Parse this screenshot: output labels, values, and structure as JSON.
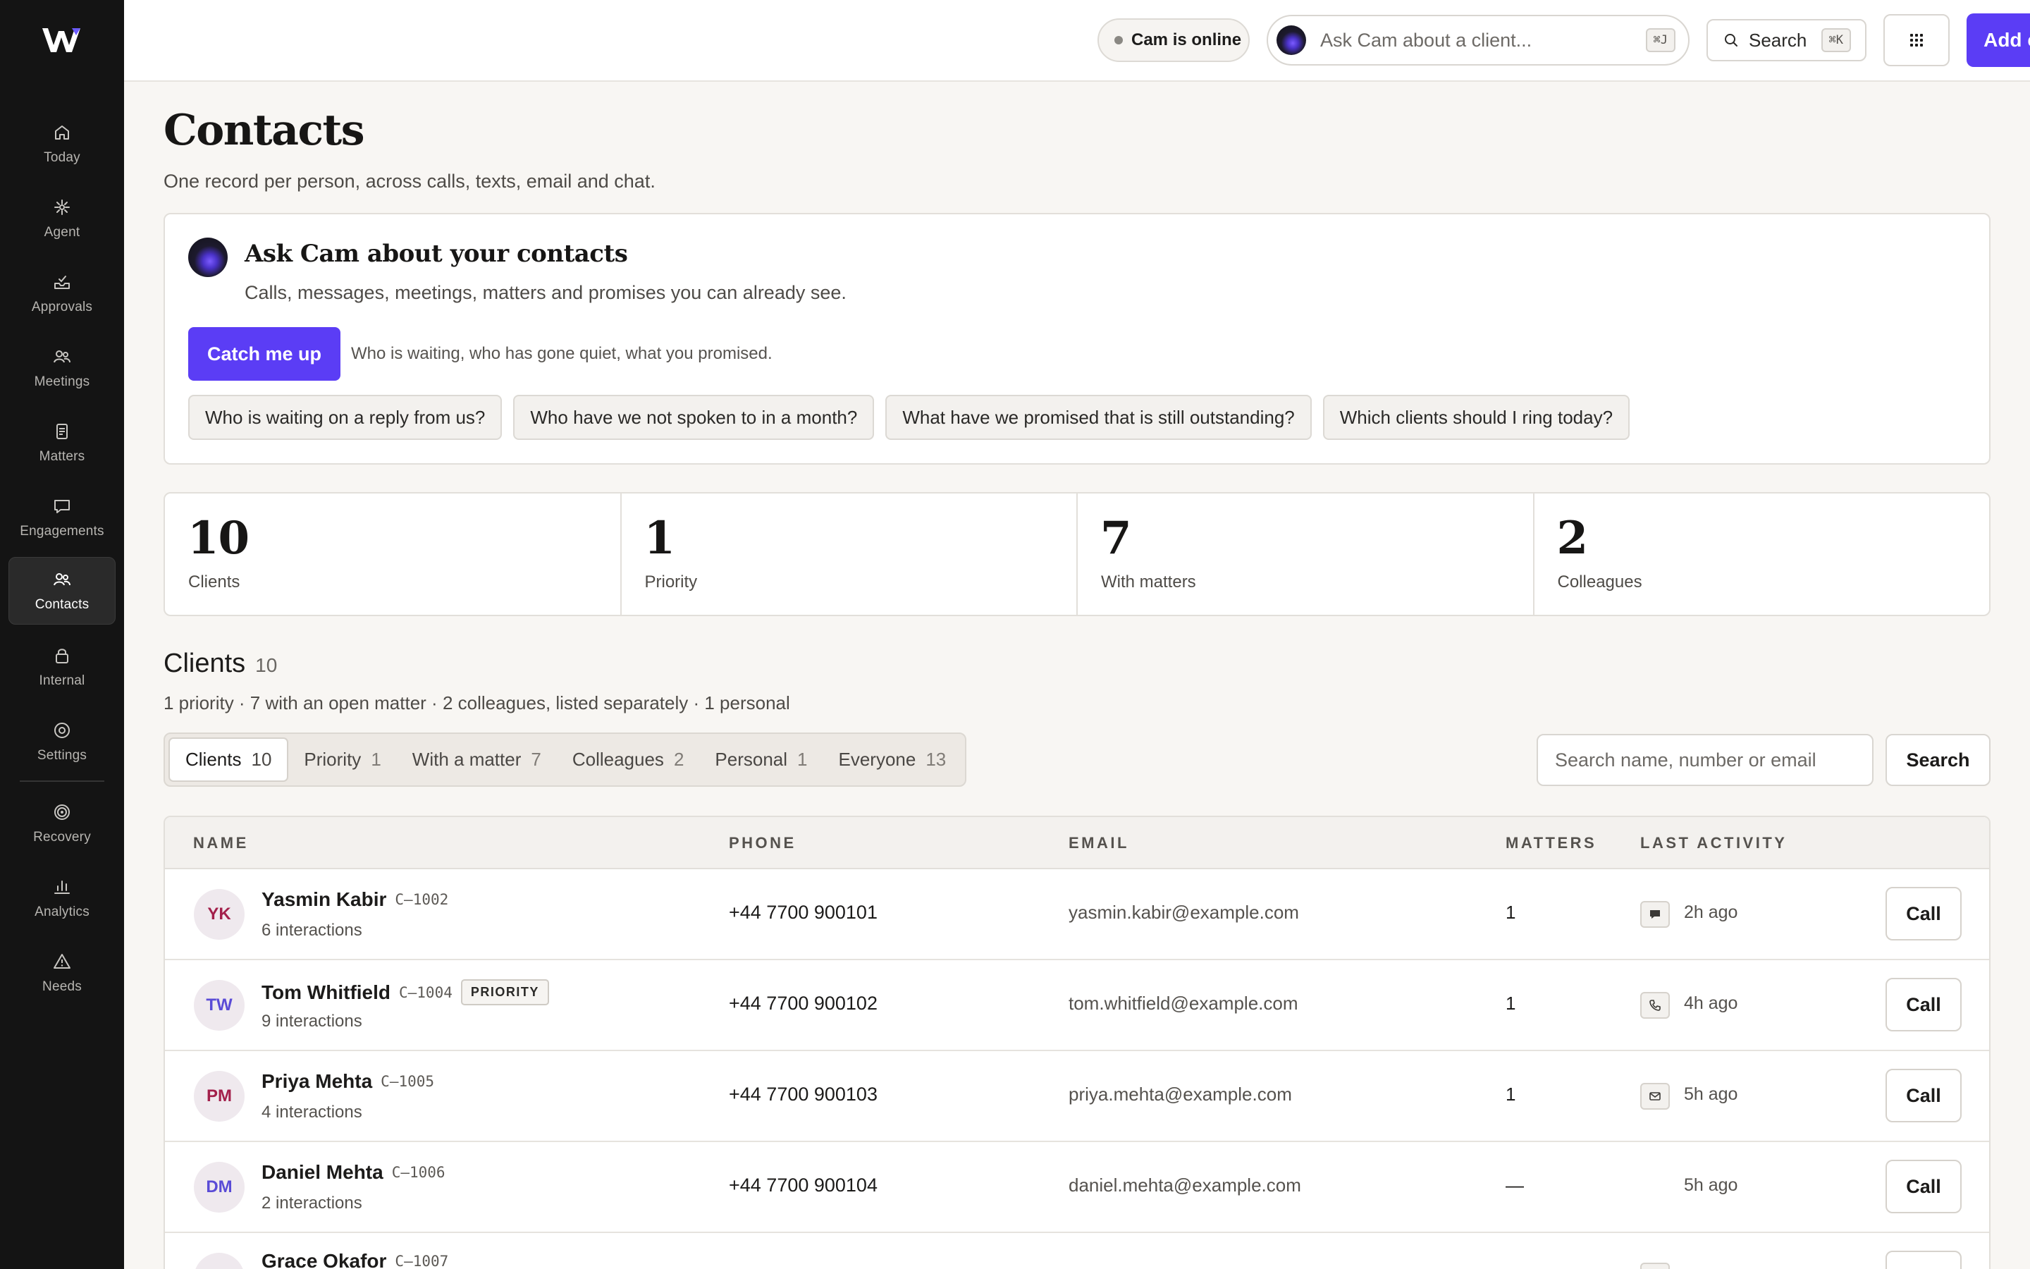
{
  "sidebar": {
    "items": [
      {
        "label": "Today",
        "icon": "home-icon"
      },
      {
        "label": "Agent",
        "icon": "sparkle-icon"
      },
      {
        "label": "Approvals",
        "icon": "inbox-icon"
      },
      {
        "label": "Meetings",
        "icon": "people-icon"
      },
      {
        "label": "Matters",
        "icon": "document-icon"
      },
      {
        "label": "Engagements",
        "icon": "chat-icon"
      },
      {
        "label": "Contacts",
        "icon": "contacts-icon"
      },
      {
        "label": "Internal",
        "icon": "lock-icon"
      },
      {
        "label": "Settings",
        "icon": "settings-icon"
      },
      {
        "label": "Recovery",
        "icon": "target-icon"
      },
      {
        "label": "Analytics",
        "icon": "bar-chart-icon"
      },
      {
        "label": "Needs",
        "icon": "warning-icon"
      }
    ],
    "active": "Contacts"
  },
  "topbar": {
    "status": "Cam is online",
    "ask_placeholder": "Ask Cam about a client...",
    "ask_shortcut": "⌘J",
    "search_label": "Search",
    "search_shortcut": "⌘K",
    "add_label": "Add contact"
  },
  "header": {
    "title": "Contacts",
    "subtitle": "One record per person, across calls, texts, email and chat."
  },
  "cam_panel": {
    "title": "Ask Cam about your contacts",
    "subtitle": "Calls, messages, meetings, matters and promises you can already see.",
    "catch_label": "Catch me up",
    "catch_hint": "Who is waiting, who has gone quiet, what you promised.",
    "prompts": [
      "Who is waiting on a reply from us?",
      "Who have we not spoken to in a month?",
      "What have we promised that is still outstanding?",
      "Which clients should I ring today?"
    ]
  },
  "stats": [
    {
      "value": "10",
      "label": "Clients"
    },
    {
      "value": "1",
      "label": "Priority"
    },
    {
      "value": "7",
      "label": "With matters"
    },
    {
      "value": "2",
      "label": "Colleagues"
    }
  ],
  "clients": {
    "title": "Clients",
    "count": "10",
    "summary": "1 priority · 7 with an open matter · 2 colleagues, listed separately · 1 personal",
    "tabs": [
      {
        "label": "Clients",
        "count": "10"
      },
      {
        "label": "Priority",
        "count": "1"
      },
      {
        "label": "With a matter",
        "count": "7"
      },
      {
        "label": "Colleagues",
        "count": "2"
      },
      {
        "label": "Personal",
        "count": "1"
      },
      {
        "label": "Everyone",
        "count": "13"
      }
    ],
    "active_tab": "Clients",
    "search_placeholder": "Search name, number or email",
    "search_button": "Search"
  },
  "table": {
    "headers": {
      "name": "NAME",
      "phone": "PHONE",
      "email": "EMAIL",
      "matters": "MATTERS",
      "activity": "LAST ACTIVITY"
    },
    "call_label": "Call",
    "rows": [
      {
        "initials": "YK",
        "initials_color": "#a3204b",
        "name": "Yasmin Kabir",
        "code": "C–1002",
        "badge": "",
        "interactions": "6 interactions",
        "phone": "+44 7700 900101",
        "email": "yasmin.kabir@example.com",
        "matters": "1",
        "activity_icon": "message-icon",
        "activity": "2h ago"
      },
      {
        "initials": "TW",
        "initials_color": "#5a4bd6",
        "name": "Tom Whitfield",
        "code": "C–1004",
        "badge": "PRIORITY",
        "interactions": "9 interactions",
        "phone": "+44 7700 900102",
        "email": "tom.whitfield@example.com",
        "matters": "1",
        "activity_icon": "phone-icon",
        "activity": "4h ago"
      },
      {
        "initials": "PM",
        "initials_color": "#a3204b",
        "name": "Priya Mehta",
        "code": "C–1005",
        "badge": "",
        "interactions": "4 interactions",
        "phone": "+44 7700 900103",
        "email": "priya.mehta@example.com",
        "matters": "1",
        "activity_icon": "mail-icon",
        "activity": "5h ago"
      },
      {
        "initials": "DM",
        "initials_color": "#5a4bd6",
        "name": "Daniel Mehta",
        "code": "C–1006",
        "badge": "",
        "interactions": "2 interactions",
        "phone": "+44 7700 900104",
        "email": "daniel.mehta@example.com",
        "matters": "—",
        "activity_icon": "",
        "activity": "5h ago"
      },
      {
        "initials": "GO",
        "initials_color": "#a3204b",
        "name": "Grace Okafor",
        "code": "C–1007",
        "badge": "",
        "interactions": "",
        "phone": "",
        "email": "",
        "matters": "",
        "activity_icon": "",
        "activity": ""
      }
    ]
  }
}
